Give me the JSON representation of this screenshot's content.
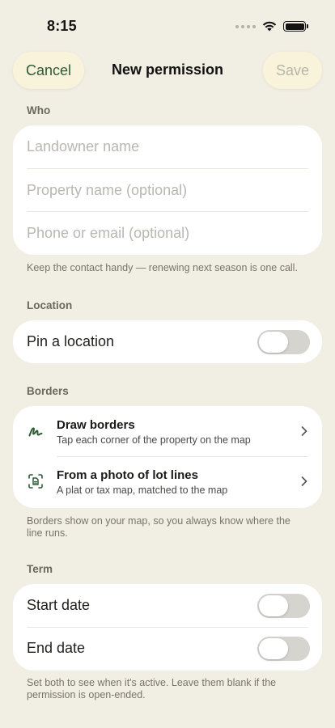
{
  "status_bar": {
    "time": "8:15"
  },
  "nav": {
    "cancel_label": "Cancel",
    "title": "New permission",
    "save_label": "Save"
  },
  "who": {
    "label": "Who",
    "fields": [
      {
        "placeholder": "Landowner name",
        "value": ""
      },
      {
        "placeholder": "Property name (optional)",
        "value": ""
      },
      {
        "placeholder": "Phone or email (optional)",
        "value": ""
      }
    ],
    "footnote": "Keep the contact handy — renewing next season is one call."
  },
  "location": {
    "label": "Location",
    "pin_label": "Pin a location",
    "pin_on": false
  },
  "borders": {
    "label": "Borders",
    "items": [
      {
        "title": "Draw borders",
        "subtitle": "Tap each corner of the property on the map",
        "icon": "draw-scribble-icon"
      },
      {
        "title": "From a photo of lot lines",
        "subtitle": "A plat or tax map, matched to the map",
        "icon": "scan-document-icon"
      }
    ],
    "footnote": "Borders show on your map, so you always know where the line runs."
  },
  "term": {
    "label": "Term",
    "start_label": "Start date",
    "start_on": false,
    "end_label": "End date",
    "end_on": false,
    "footnote": "Set both to see when it's active. Leave them blank if the permission is open-ended."
  },
  "colors": {
    "accent": "#2d5a36",
    "background": "#f1eee4",
    "pill": "#f8f3da",
    "toggle_off": "#d6d4cf"
  }
}
